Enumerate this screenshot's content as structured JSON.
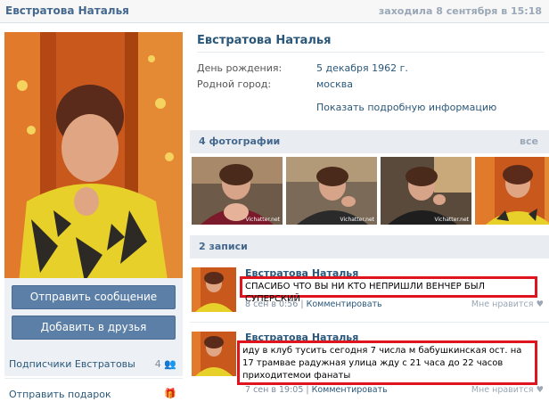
{
  "header": {
    "name": "Евстратова Наталья",
    "last_seen": "заходила 8 сентября в 15:18"
  },
  "sidebar": {
    "send_message": "Отправить сообщение",
    "add_friend": "Добавить в друзья",
    "subscribers_label": "Подписчики Евстратовы",
    "subscribers_count": "4",
    "gift_label": "Отправить подарок"
  },
  "profile": {
    "name": "Евстратова Наталья",
    "birthday_label": "День рождения:",
    "birthday_value": "5 декабря 1962 г.",
    "hometown_label": "Родной город:",
    "hometown_value": "москва",
    "more_info": "Показать подробную информацию"
  },
  "photos_section": {
    "title": "4 фотографии",
    "all": "все",
    "watermarks": [
      "Vichatter.net",
      "Vichatter.net",
      "Vichatter.net"
    ]
  },
  "posts_section": {
    "title": "2 записи"
  },
  "posts": [
    {
      "author": "Евстратова Наталья",
      "text": "СПАСИБО ЧТО ВЫ НИ КТО НЕПРИШЛИ ВЕНЧЕР БЫЛ СУПЕРСКИЙ",
      "date": "8 сен в 0:56",
      "separator": "|",
      "comment": "Комментировать",
      "like": "Мне нравится"
    },
    {
      "author": "Евстратова Наталья",
      "text": "иду в клуб тусить сегодня 7 числа м бабушкинская ост. на 17 трамвае радужная улица жду с 21 часа до 22 часов приходитемои фанаты",
      "date": "7 сен в 19:05",
      "separator": "|",
      "comment": "Комментировать",
      "like": "Мне нравится"
    }
  ],
  "colors": {
    "link": "#2b587a",
    "header_name": "#45688e",
    "button": "#5b7fa6",
    "highlight": "#e0141e"
  }
}
